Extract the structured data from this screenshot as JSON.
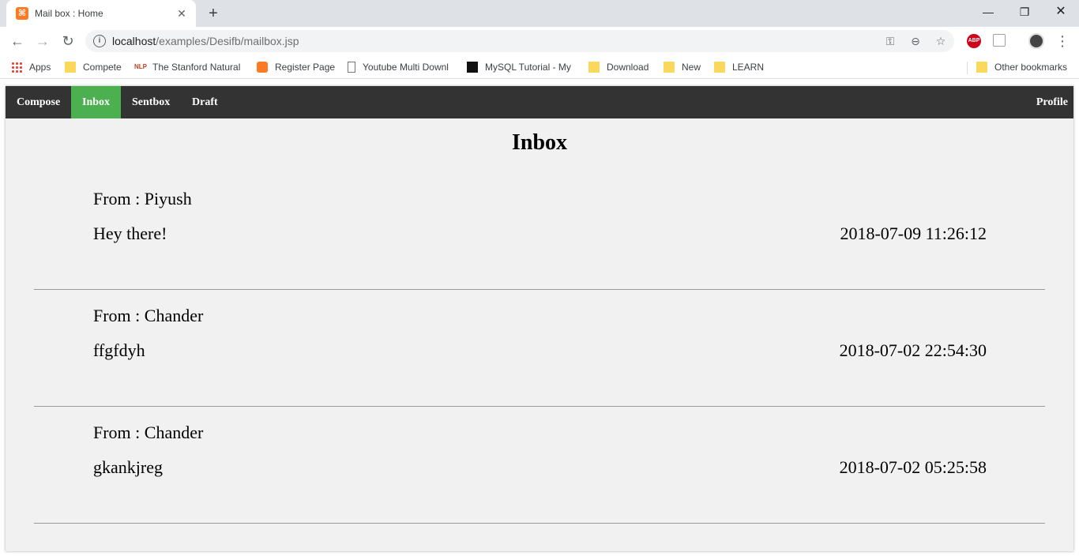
{
  "browser": {
    "tab_title": "Mail box : Home",
    "url_host": "localhost",
    "url_path": "/examples/Desifb/mailbox.jsp",
    "bookmarks": [
      {
        "label": "Apps",
        "icon": "apps-icon"
      },
      {
        "label": "Compete",
        "icon": "folder-icon"
      },
      {
        "label": "The Stanford Natural",
        "icon": "nlp-icon"
      },
      {
        "label": "Register Page",
        "icon": "xampp-icon"
      },
      {
        "label": "Youtube Multi Downl",
        "icon": "page-icon"
      },
      {
        "label": "MySQL Tutorial - My",
        "icon": "terminal-icon"
      },
      {
        "label": "Download",
        "icon": "folder-icon"
      },
      {
        "label": "New",
        "icon": "folder-icon"
      },
      {
        "label": "LEARN",
        "icon": "folder-icon"
      }
    ],
    "other_bookmarks": "Other bookmarks",
    "abp_label": "ABP"
  },
  "nav": {
    "compose": "Compose",
    "inbox": "Inbox",
    "sentbox": "Sentbox",
    "draft": "Draft",
    "profile": "Profile",
    "active": "inbox",
    "active_color": "#4caf50",
    "bar_color": "#333333"
  },
  "page": {
    "title": "Inbox"
  },
  "mails": [
    {
      "from": "From : Piyush",
      "subject": "Hey there!",
      "date": "2018-07-09 11:26:12"
    },
    {
      "from": "From : Chander",
      "subject": "ffgfdyh",
      "date": "2018-07-02 22:54:30"
    },
    {
      "from": "From : Chander",
      "subject": "gkankjreg",
      "date": "2018-07-02 05:25:58"
    }
  ]
}
